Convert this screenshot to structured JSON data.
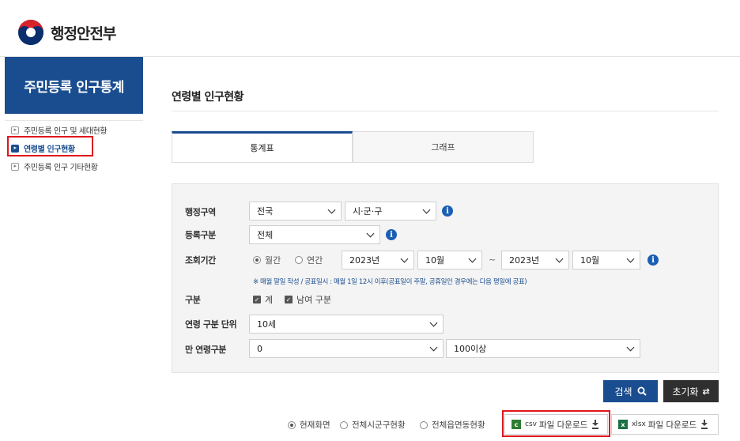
{
  "header": {
    "logo_text": "행정안전부"
  },
  "sidebar": {
    "title": "주민등록 인구통계",
    "items": [
      {
        "label": "주민등록 인구 및 세대현황"
      },
      {
        "label": "연령별 인구현황"
      },
      {
        "label": "주민등록 인구 기타현황"
      }
    ]
  },
  "main": {
    "page_title": "연령별 인구현황",
    "tabs": [
      {
        "label": "통계표"
      },
      {
        "label": "그래프"
      }
    ],
    "form": {
      "region_label": "행정구역",
      "region_sido": "전국",
      "region_sigungu": "시·군·구",
      "reg_type_label": "등록구분",
      "reg_type": "전체",
      "period_label": "조회기간",
      "period_monthly": "월간",
      "period_yearly": "연간",
      "from_year": "2023년",
      "from_month": "10월",
      "tilde": "~",
      "to_year": "2023년",
      "to_month": "10월",
      "note": "※ 매월 말일 작성 / 공표일시 : 매월 1일 12시 이후(공표일이 주말, 공휴일인 경우에는 다음 평일에 공표)",
      "category_label": "구분",
      "check_total": "계",
      "check_gender": "남여 구분",
      "age_unit_label": "연령 구분 단위",
      "age_unit": "10세",
      "age_range_label": "만 연령구분",
      "age_from": "0",
      "age_to": "100이상"
    },
    "buttons": {
      "search": "검색",
      "reset": "초기화"
    },
    "bottom": {
      "radio_current": "현재화면",
      "radio_sigungu": "전체시군구현황",
      "radio_eupmyeondong": "전체읍면동현황",
      "csv_ext": "csv",
      "csv_label": "파일 다운로드",
      "xlsx_ext": "xlsx",
      "xlsx_label": "파일 다운로드"
    }
  },
  "colors": {
    "brand": "#1a4d8f",
    "highlight": "#e0151c",
    "csv_icon": "#2e7d32",
    "xlsx_icon": "#1d7044"
  }
}
